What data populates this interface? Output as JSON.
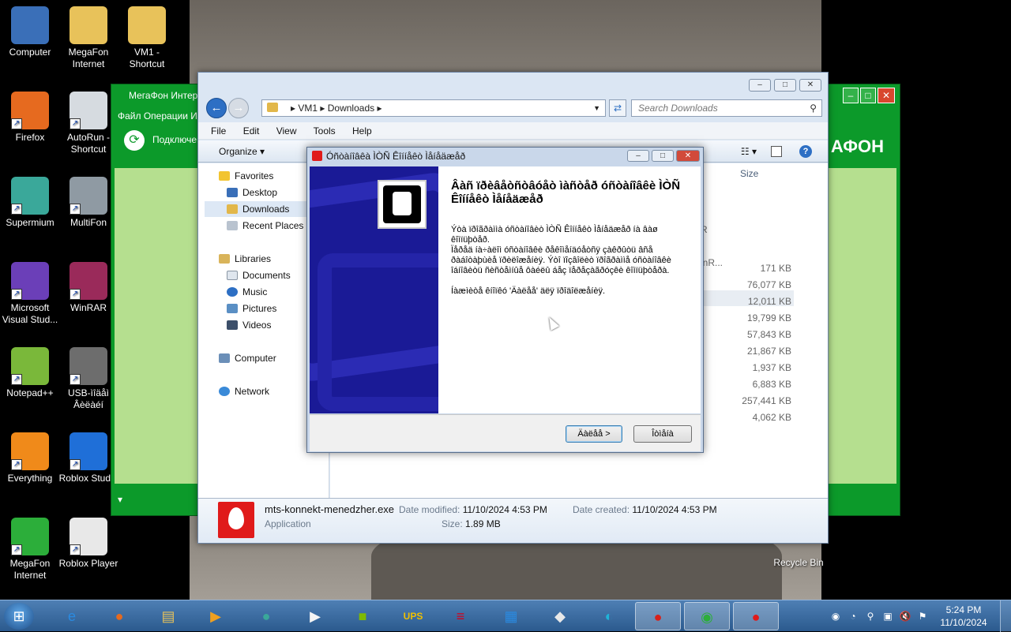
{
  "desktop": {
    "icons": [
      {
        "label": "Computer",
        "color": "#3a6fb8"
      },
      {
        "label": "MegaFon Internet",
        "color": "#e8c25a"
      },
      {
        "label": "VM1 - Shortcut",
        "color": "#e8c25a"
      },
      {
        "label": "Firefox",
        "color": "#e66a1f"
      },
      {
        "label": "AutoRun - Shortcut",
        "color": "#d6dbe0"
      },
      {
        "label": "Supermium",
        "color": "#3aa89a"
      },
      {
        "label": "MultiFon",
        "color": "#8f9aa3"
      },
      {
        "label": "Microsoft Visual Stud...",
        "color": "#6b3fb8"
      },
      {
        "label": "WinRAR",
        "color": "#9a2a5a"
      },
      {
        "label": "Notepad++",
        "color": "#7ab83a"
      },
      {
        "label": "USB-ìîäåì Âèëàéí",
        "color": "#6d6d6d"
      },
      {
        "label": "Everything",
        "color": "#f08a1a"
      },
      {
        "label": "Roblox Studio",
        "color": "#1f6fd8"
      },
      {
        "label": "MegaFon Internet",
        "color": "#2cae3a"
      },
      {
        "label": "Roblox Player",
        "color": "#e8e8e8"
      }
    ],
    "recycle_label": "Recycle Bin"
  },
  "megafon_window": {
    "title": "МегаФон Интер",
    "menu": "Файл Операции И",
    "tool_label": "Подключен",
    "brand": "АФОН"
  },
  "explorer": {
    "path": [
      "VM1",
      "Downloads"
    ],
    "search_placeholder": "Search Downloads",
    "menu": [
      "File",
      "Edit",
      "View",
      "Tools",
      "Help"
    ],
    "organize": "Organize",
    "size_header": "Size",
    "nav": {
      "favorites": "Favorites",
      "desktop": "Desktop",
      "downloads": "Downloads",
      "recent": "Recent Places",
      "libraries": "Libraries",
      "documents": "Documents",
      "music": "Music",
      "pictures": "Pictures",
      "videos": "Videos",
      "computer": "Computer",
      "network": "Network"
    },
    "sizes": [
      "171 KB",
      "76,077 KB",
      "12,011 KB",
      "19,799 KB",
      "57,843 KB",
      "21,867 KB",
      "1,937 KB",
      "6,883 KB",
      "257,441 KB",
      "4,062 KB"
    ],
    "partial_texts": [
      "R",
      "inR..."
    ],
    "details": {
      "filename": "mts-konnekt-menedzher.exe",
      "filetype": "Application",
      "modified_label": "Date modified:",
      "modified_value": "11/10/2024 4:53 PM",
      "size_label": "Size:",
      "size_value": "1.89 MB",
      "created_label": "Date created:",
      "created_value": "11/10/2024 4:53 PM"
    }
  },
  "installer": {
    "title": "Óñòàíîâêà ÌÒÑ Êîííåêò Ìåíåäæåð",
    "heading": "Âàñ ïðèâåòñòâóåò ìàñòåð óñòàíîâêè ÌÒÑ Êîííåêò Ìåíåäæåð",
    "p1": "Ýòà ïðîãðàììà óñòàíîâèò ÌÒÑ Êîííåêò Ìåíåäæåð íà âàø êîìïüþòåð.",
    "p2": "Ïåðåä íà÷àëîì óñòàíîâêè ðåêîìåíäóåòñÿ çàêðûòü âñå ðàáîòàþùèå ïðèëîæåíèÿ. Ýòî ïîçâîëèò ïðîãðàììå óñòàíîâêè îáíîâèòü ñèñòåìíûå ôàéëû áåç ïåðåçàãðóçêè êîìïüþòåðà.",
    "p3": "Íàæìèòå êíîïêó 'Äàëåå' äëÿ ïðîäîëæåíèÿ.",
    "next_button": "Äàëåå >",
    "cancel_button": "Îòìåíà"
  },
  "taskbar": {
    "items": [
      {
        "name": "internet-explorer",
        "glyph": "e",
        "color": "#2a8ae0"
      },
      {
        "name": "firefox",
        "glyph": "●",
        "color": "#e66a1f"
      },
      {
        "name": "file-explorer",
        "glyph": "▤",
        "color": "#e8c25a"
      },
      {
        "name": "media-player",
        "glyph": "▶",
        "color": "#f0a020"
      },
      {
        "name": "supermium",
        "glyph": "●",
        "color": "#3aa89a"
      },
      {
        "name": "youtube",
        "glyph": "▶",
        "color": "#f5f5f5"
      },
      {
        "name": "microsoft",
        "glyph": "■",
        "color": "#7fba00"
      },
      {
        "name": "ups",
        "glyph": "UPS",
        "color": "#5a3a1a"
      },
      {
        "name": "bank-of-america",
        "glyph": "≡",
        "color": "#d4001a"
      },
      {
        "name": "microsoft-store",
        "glyph": "▦",
        "color": "#2a8ae0"
      },
      {
        "name": "roblox",
        "glyph": "◆",
        "color": "#e8e8e8"
      },
      {
        "name": "edge",
        "glyph": "◐",
        "color": "#1fb4d8"
      },
      {
        "name": "angry-birds",
        "glyph": "●",
        "color": "#d8201a"
      },
      {
        "name": "megafon-internet",
        "glyph": "◉",
        "color": "#2cae3a"
      },
      {
        "name": "mts-connect",
        "glyph": "●",
        "color": "#e01a1a"
      }
    ],
    "time": "5:24 PM",
    "date": "11/10/2024"
  }
}
